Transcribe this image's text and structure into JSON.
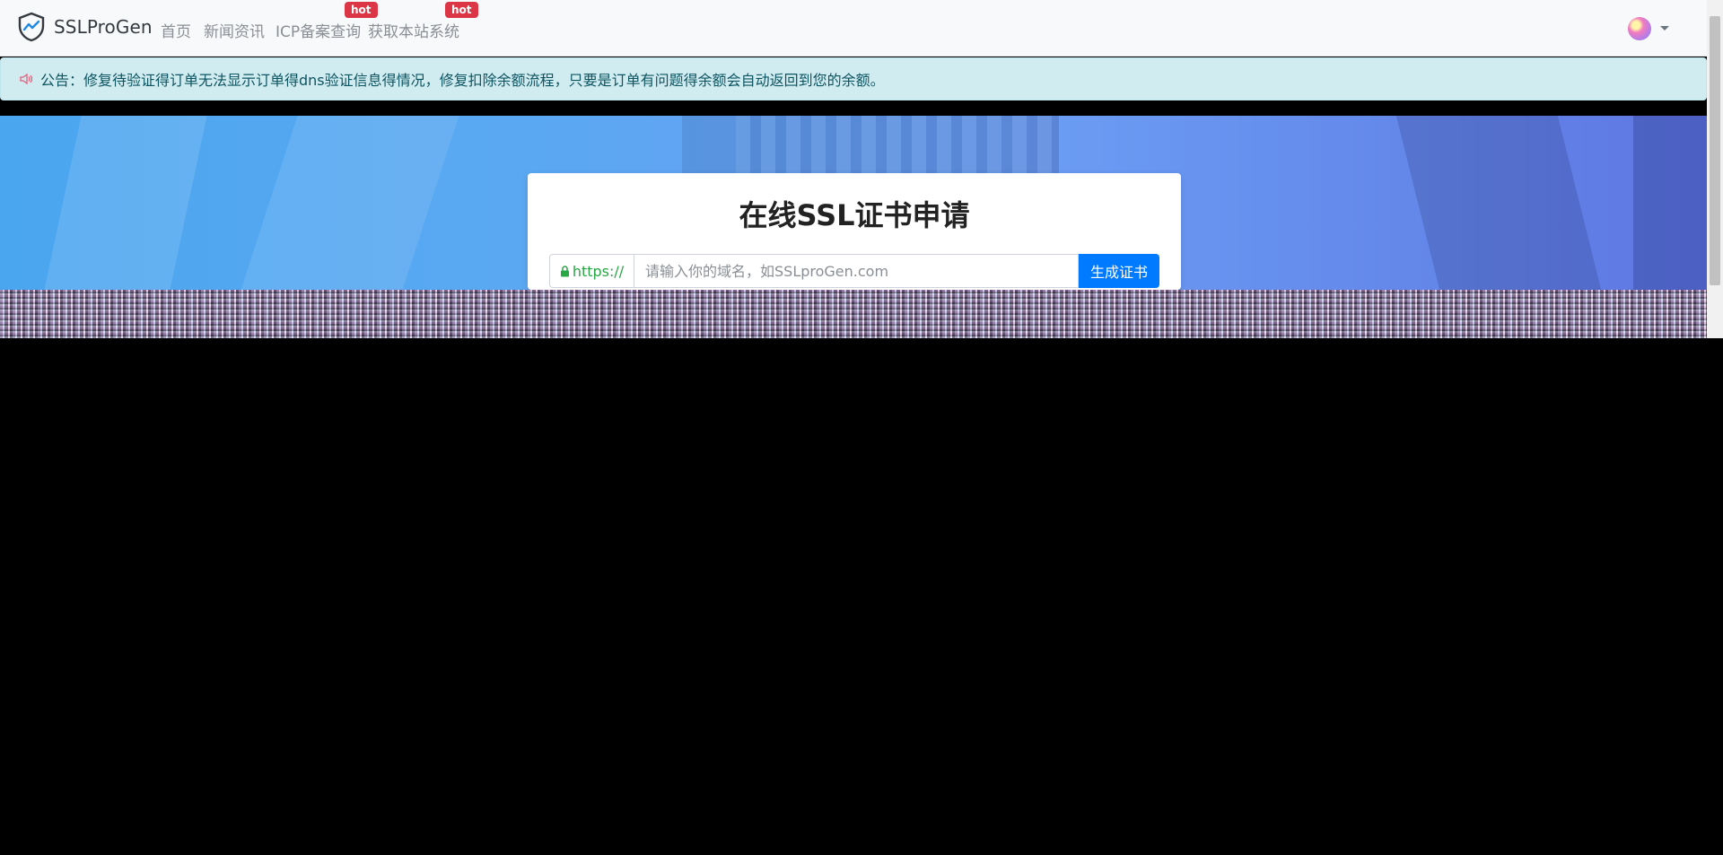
{
  "navbar": {
    "brand": "SSLProGen",
    "links": [
      {
        "label": "首页"
      },
      {
        "label": "新闻资讯"
      },
      {
        "label": "ICP备案查询",
        "badge": "hot"
      },
      {
        "label": "获取本站系统",
        "badge": "hot"
      }
    ],
    "user_avatar_icon": "avatar-icon"
  },
  "notice": {
    "icon": "speaker-icon",
    "text": "公告：修复待验证得订单无法显示订单得dns验证信息得情况，修复扣除余额流程，只要是订单有问题得余额会自动返回到您的余额。"
  },
  "hero": {
    "title": "在线SSL证书申请",
    "prefix": "https://",
    "input_placeholder": "请输入你的域名，如SSLproGen.com",
    "submit_label": "生成证书"
  },
  "colors": {
    "accent": "#007bff",
    "notice_bg": "#d1ecf1",
    "badge": "#dc3545",
    "prefix_green": "#28a745"
  }
}
